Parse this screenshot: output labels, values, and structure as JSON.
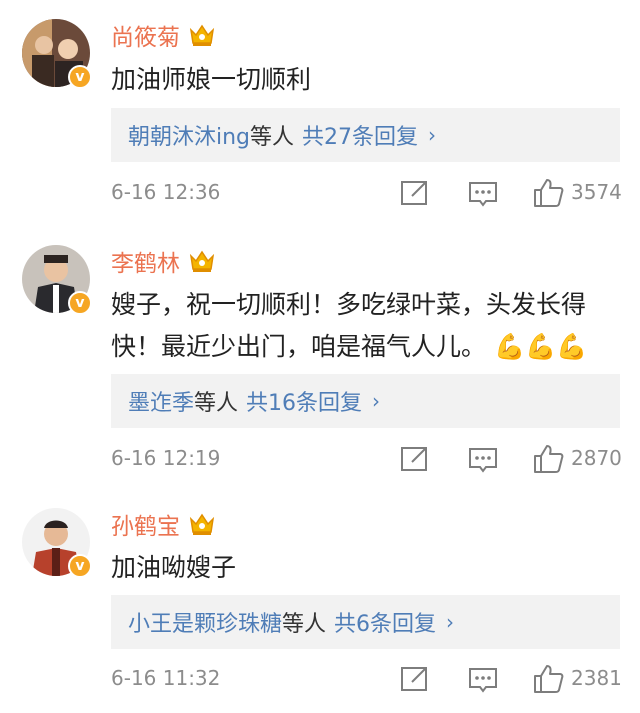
{
  "comments": [
    {
      "username": "尚筱菊",
      "text": "加油师娘一切顺利",
      "replies": {
        "who": "朝朝沐沐ing",
        "suffix": "等人",
        "count": "共27条回复"
      },
      "time": "6-16 12:36",
      "likes": "3574"
    },
    {
      "username": "李鹤林",
      "text": "嫂子，祝一切顺利！多吃绿叶菜，头发长得快！最近少出门，咱是福气人儿。",
      "emoji": [
        "muscle-emoji",
        "muscle-emoji",
        "muscle-emoji"
      ],
      "replies": {
        "who": "墨迮季",
        "suffix": "等人",
        "count": "共16条回复"
      },
      "time": "6-16 12:19",
      "likes": "2870"
    },
    {
      "username": "孙鹤宝",
      "text": "加油呦嫂子",
      "replies": {
        "who": "小王是颗珍珠糖",
        "suffix": "等人",
        "count": "共6条回复"
      },
      "time": "6-16 11:32",
      "likes": "2381"
    }
  ],
  "badge_text": "v",
  "chevron": "›",
  "colors": {
    "username": "#eb7350",
    "link": "#4f7db7",
    "meta": "#8c8c8c",
    "reply_bg": "#f2f2f2",
    "badge": "#f6a623"
  }
}
